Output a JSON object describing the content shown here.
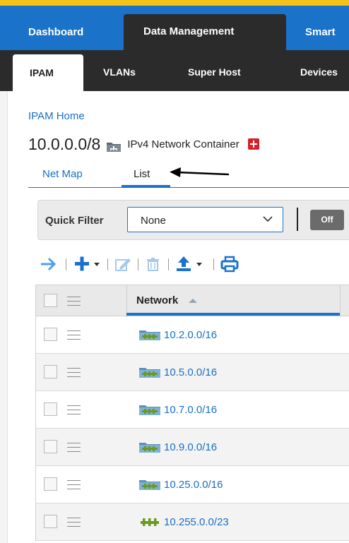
{
  "top_nav": {
    "tabs": [
      {
        "label": "Dashboard"
      },
      {
        "label": "Data Management"
      },
      {
        "label": "Smart"
      }
    ],
    "active_index": 1
  },
  "sub_nav": {
    "tabs": [
      {
        "label": "IPAM"
      },
      {
        "label": "VLANs"
      },
      {
        "label": "Super Host"
      },
      {
        "label": "Devices"
      }
    ],
    "active_index": 0
  },
  "breadcrumb": {
    "label": "IPAM Home"
  },
  "title": {
    "main": "10.0.0.0/8",
    "sub": "IPv4 Network Container",
    "icon": "network-container-icon"
  },
  "view_tabs": {
    "tabs": [
      {
        "label": "Net Map"
      },
      {
        "label": "List"
      }
    ],
    "active_index": 1
  },
  "quick_filter": {
    "label": "Quick Filter",
    "value": "None",
    "toggle": "Off"
  },
  "toolbar": {
    "icons": [
      "arrow-right-icon",
      "add-icon",
      "edit-icon",
      "delete-icon",
      "import-icon",
      "print-icon"
    ]
  },
  "grid": {
    "columns": [
      {
        "label": "Network",
        "sort": "asc"
      }
    ],
    "rows": [
      {
        "network": "10.2.0.0/16",
        "type": "container"
      },
      {
        "network": "10.5.0.0/16",
        "type": "container"
      },
      {
        "network": "10.7.0.0/16",
        "type": "container"
      },
      {
        "network": "10.9.0.0/16",
        "type": "container"
      },
      {
        "network": "10.25.0.0/16",
        "type": "container"
      },
      {
        "network": "10.255.0.0/23",
        "type": "network"
      }
    ]
  },
  "colors": {
    "brand_blue": "#1a72c9",
    "nav_dark": "#2b2b2b",
    "accent_gold": "#f3c319",
    "link_blue": "#1a6fc4",
    "network_green": "#6a9a1f",
    "flag_red": "#d5202a"
  }
}
